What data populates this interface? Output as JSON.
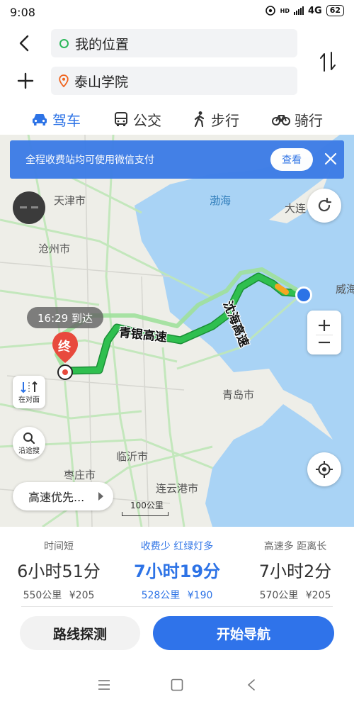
{
  "status_bar": {
    "time": "9:08",
    "network": "4G",
    "network_small": "HD",
    "battery": "62"
  },
  "route": {
    "start": {
      "text": "我的位置"
    },
    "end": {
      "text": "泰山学院"
    }
  },
  "modes": [
    {
      "label": "驾车",
      "active": true
    },
    {
      "label": "公交",
      "active": false
    },
    {
      "label": "步行",
      "active": false
    },
    {
      "label": "骑行",
      "active": false
    }
  ],
  "banner": {
    "text": "全程收费站均可使用微信支付",
    "button": "查看"
  },
  "map": {
    "labels": {
      "tianjin": "天津市",
      "cangzhou": "沧州市",
      "bohai": "渤海",
      "dalian": "大连",
      "weihai": "威海",
      "qingdao": "青岛市",
      "linyi": "临沂市",
      "zaozhuang": "枣庄市",
      "lianyungang": "连云港市"
    },
    "roads": {
      "qingyin": "青银高速",
      "shenhai": "沈海高速"
    },
    "arrival": "16:29 到达",
    "end_marker": "终",
    "opposite_label": "在对面",
    "along_search_label": "沿途搜",
    "route_pref": "高速优先...",
    "scale": "100公里"
  },
  "options": [
    {
      "tag": "时间短",
      "duration": "6小时51分",
      "distance": "550公里",
      "fee": "¥205",
      "selected": false
    },
    {
      "tag": "收费少 红绿灯多",
      "duration": "7小时19分",
      "distance": "528公里",
      "fee": "¥190",
      "selected": true
    },
    {
      "tag": "高速多 距离长",
      "duration": "7小时2分",
      "distance": "570公里",
      "fee": "¥205",
      "selected": false
    }
  ],
  "actions": {
    "probe": "路线探测",
    "navigate": "开始导航"
  },
  "colors": {
    "accent": "#2d73e6",
    "route_green": "#2fbf4f",
    "sea": "#a9d3f5",
    "banner": "#3e7de6",
    "end_marker": "#e84a3d"
  }
}
